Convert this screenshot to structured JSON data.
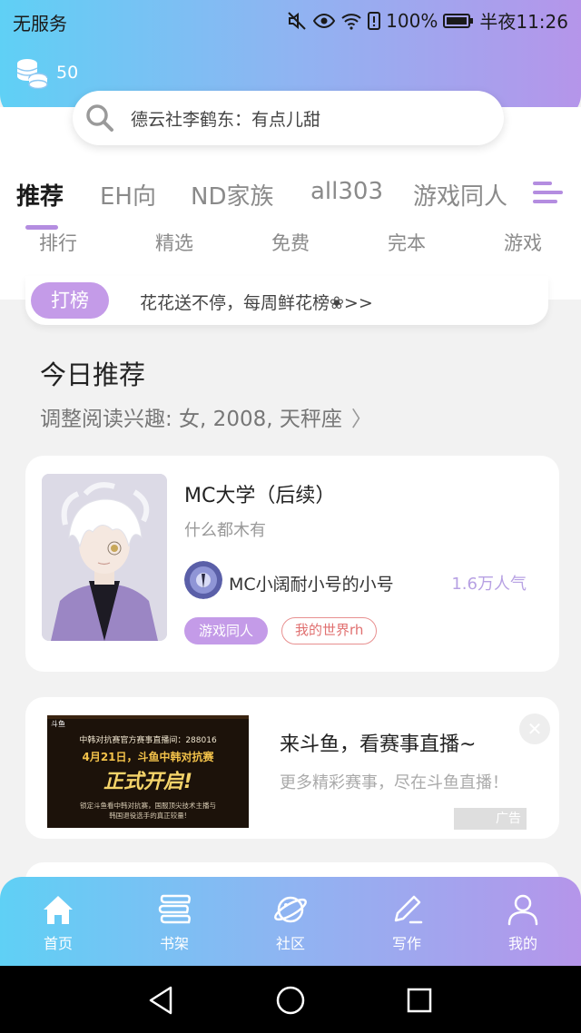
{
  "status_bar": {
    "carrier": "无服务",
    "battery_percent": "100%",
    "time": "半夜11:26"
  },
  "coins": {
    "count": "50"
  },
  "search": {
    "placeholder": "德云社李鹤东：有点儿甜"
  },
  "tabs": [
    {
      "label": "推荐",
      "active": true
    },
    {
      "label": "EH向"
    },
    {
      "label": "ND家族"
    },
    {
      "label": "all303"
    },
    {
      "label": "游戏同人"
    }
  ],
  "subcategories": [
    "排行",
    "精选",
    "免费",
    "完本",
    "游戏"
  ],
  "rank_strip": {
    "badge": "打榜",
    "text": "花花送不停，每周鲜花榜❀>>"
  },
  "today": {
    "title": "今日推荐",
    "subtitle": "调整阅读兴趣: 女, 2008, 天秤座"
  },
  "book": {
    "title": "MC大学（后续）",
    "description": "什么都木有",
    "author": "MC小阔耐小号的小号",
    "popularity": "1.6万人气",
    "tags": [
      "游戏同人",
      "我的世界rh"
    ]
  },
  "ad": {
    "title": "来斗鱼，看赛事直播~",
    "description": "更多精彩赛事，尽在斗鱼直播！",
    "badge": "广告",
    "image": {
      "logo": "斗鱼",
      "room_line": "中韩对抗赛官方赛事直播间：288016",
      "headline": "4月21日，斗鱼中韩对抗赛",
      "big": "正式开启!",
      "small1": "锁定斗鱼看中韩对抗赛，国服顶尖技术主播与",
      "small2": "韩国退役选手的真正较量!"
    }
  },
  "bottom_nav": [
    {
      "label": "首页",
      "icon": "home-icon"
    },
    {
      "label": "书架",
      "icon": "bookshelf-icon"
    },
    {
      "label": "社区",
      "icon": "planet-icon"
    },
    {
      "label": "写作",
      "icon": "pen-icon"
    },
    {
      "label": "我的",
      "icon": "user-icon"
    }
  ],
  "colors": {
    "gradient_start": "#5fd0f5",
    "gradient_end": "#b595ea",
    "accent_purple": "#c49be8"
  }
}
